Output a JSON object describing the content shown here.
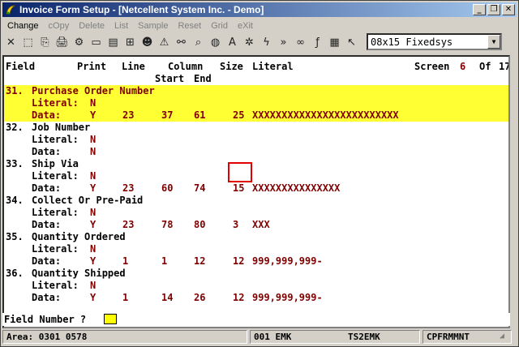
{
  "window": {
    "title": "Invoice Form Setup - [Netcellent System Inc. - Demo]",
    "minimize_glyph": "_",
    "restore_glyph": "❐",
    "close_glyph": "✕"
  },
  "menu": {
    "items": [
      {
        "label": "Change",
        "active": true
      },
      {
        "label": "cOpy",
        "active": false
      },
      {
        "label": "Delete",
        "active": false
      },
      {
        "label": "List",
        "active": false
      },
      {
        "label": "Sample",
        "active": false
      },
      {
        "label": "Reset",
        "active": false
      },
      {
        "label": "Grid",
        "active": false
      },
      {
        "label": "eXit",
        "active": false
      }
    ]
  },
  "toolbar": {
    "icons": [
      {
        "name": "close-x-icon",
        "glyph": "✕"
      },
      {
        "name": "select-box-icon",
        "glyph": "⬚"
      },
      {
        "name": "copy-icon",
        "glyph": "⎘"
      },
      {
        "name": "print-icon",
        "glyph": "🖨"
      },
      {
        "name": "settings-icon",
        "glyph": "⚙"
      },
      {
        "name": "window-icon",
        "glyph": "▭"
      },
      {
        "name": "document-icon",
        "glyph": "▤"
      },
      {
        "name": "tree-icon",
        "glyph": "⊞"
      },
      {
        "name": "user-icon",
        "glyph": "☻"
      },
      {
        "name": "warning-icon",
        "glyph": "⚠"
      },
      {
        "name": "binoculars-icon",
        "glyph": "⚯"
      },
      {
        "name": "magnifier-icon",
        "glyph": "⌕"
      },
      {
        "name": "globe-icon",
        "glyph": "◍"
      },
      {
        "name": "font-icon",
        "glyph": "A"
      },
      {
        "name": "gear-icon",
        "glyph": "✲"
      },
      {
        "name": "lightning-icon",
        "glyph": "ϟ"
      },
      {
        "name": "run-icon",
        "glyph": "»"
      },
      {
        "name": "link-icon",
        "glyph": "∞"
      },
      {
        "name": "function-icon",
        "glyph": "ƒ"
      },
      {
        "name": "calculator-icon",
        "glyph": "▦"
      },
      {
        "name": "help-pointer-icon",
        "glyph": "↖"
      }
    ],
    "font_select_value": "08x15 Fixedsys"
  },
  "screen": {
    "header": {
      "field": "Field",
      "print": "Print",
      "line": "Line",
      "column": "Column",
      "size": "Size",
      "literal": "Literal",
      "start": "Start",
      "end": "End",
      "screen_label": "Screen",
      "screen_num": "6",
      "of_label": "Of",
      "of_num": "17"
    },
    "literal_label": "Literal:",
    "data_label": "Data:",
    "fields": [
      {
        "num": "31.",
        "name": "Purchase Order Number",
        "literal": "N",
        "print": "Y",
        "line": "23",
        "start": "37",
        "end": "61",
        "size": "25",
        "text": "XXXXXXXXXXXXXXXXXXXXXXXXX"
      },
      {
        "num": "32.",
        "name": "Job Number",
        "literal": "N",
        "print": "N",
        "line": "",
        "start": "",
        "end": "",
        "size": "",
        "text": ""
      },
      {
        "num": "33.",
        "name": "Ship Via",
        "literal": "N",
        "print": "Y",
        "line": "23",
        "start": "60",
        "end": "74",
        "size": "15",
        "text": "XXXXXXXXXXXXXXX"
      },
      {
        "num": "34.",
        "name": "Collect Or Pre-Paid",
        "literal": "N",
        "print": "Y",
        "line": "23",
        "start": "78",
        "end": "80",
        "size": "3",
        "text": "XXX"
      },
      {
        "num": "35.",
        "name": "Quantity Ordered",
        "literal": "N",
        "print": "Y",
        "line": "1",
        "start": "1",
        "end": "12",
        "size": "12",
        "text": "999,999,999-"
      },
      {
        "num": "36.",
        "name": "Quantity Shipped",
        "literal": "N",
        "print": "Y",
        "line": "1",
        "start": "14",
        "end": "26",
        "size": "12",
        "text": "999,999,999-"
      }
    ]
  },
  "prompt": {
    "text": "Field Number ?"
  },
  "status": {
    "area": "Area: 0301 0578",
    "company": "001 EMK",
    "terminal": "TS2EMK",
    "program": "CPFRMMNT"
  },
  "colors": {
    "highlight": "#ffff33",
    "value_text": "#800000",
    "red_box": "#e00000"
  }
}
